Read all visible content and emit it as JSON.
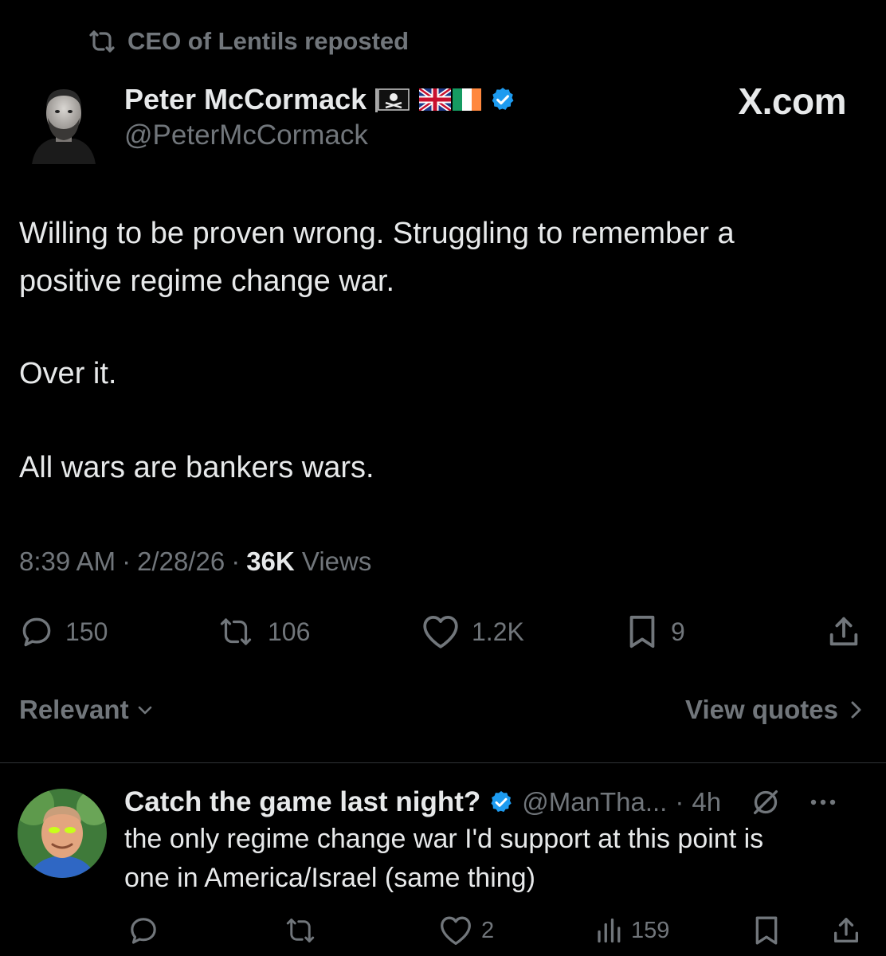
{
  "repost": {
    "label": "CEO of Lentils reposted"
  },
  "author": {
    "name": "Peter McCormack",
    "handle": "@PeterMcCormack",
    "name_emojis": [
      "pirate-flag",
      "uk-flag",
      "ireland-flag"
    ],
    "verified": true
  },
  "site_label": "X.com",
  "tweet": {
    "lines": [
      "Willing to be proven wrong. Struggling to remember a",
      "positive regime change war.",
      "Over it.",
      "All wars are bankers wars."
    ],
    "time": "8:39 AM",
    "date": "2/28/26",
    "separator": "·",
    "views_count": "36K",
    "views_label": "Views"
  },
  "actions": {
    "replies": "150",
    "reposts": "106",
    "likes": "1.2K",
    "bookmarks": "9"
  },
  "sort": {
    "label": "Relevant",
    "view_quotes": "View quotes"
  },
  "reply": {
    "name": "Catch the game last night?",
    "verified": true,
    "handle": "@ManTha...",
    "separator": "·",
    "time": "4h",
    "lines": [
      "the only regime change war I'd support at this point is",
      "one in America/Israel (same thing)"
    ],
    "actions": {
      "likes": "2",
      "views": "159"
    }
  },
  "colors": {
    "background": "#000000",
    "text": "#e7e9ea",
    "muted": "#71767b",
    "verified": "#1d9bf0",
    "divider": "#2f3336"
  }
}
